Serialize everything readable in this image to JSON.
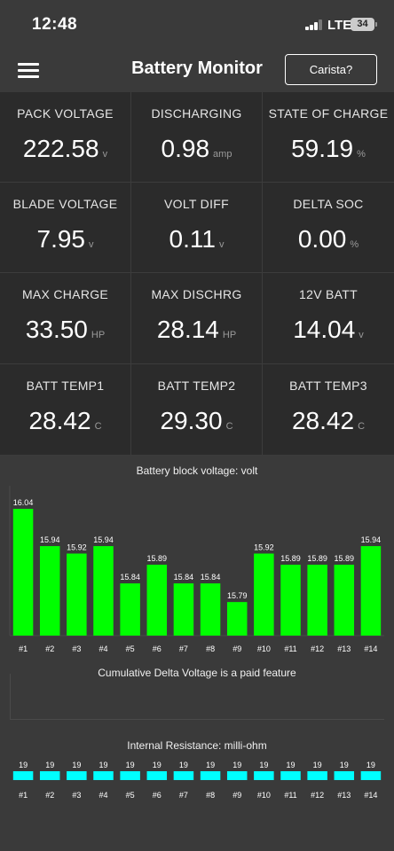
{
  "status_bar": {
    "time": "12:48",
    "network": "LTE",
    "battery_level": "34"
  },
  "header": {
    "title": "Battery Monitor",
    "button_label": "Carista?"
  },
  "metrics": [
    {
      "label": "PACK VOLTAGE",
      "value": "222.58",
      "unit": "v"
    },
    {
      "label": "DISCHARGING",
      "value": "0.98",
      "unit": "amp"
    },
    {
      "label": "STATE OF CHARGE",
      "value": "59.19",
      "unit": "%"
    },
    {
      "label": "BLADE VOLTAGE",
      "value": "7.95",
      "unit": "v"
    },
    {
      "label": "VOLT DIFF",
      "value": "0.11",
      "unit": "v"
    },
    {
      "label": "DELTA SOC",
      "value": "0.00",
      "unit": "%"
    },
    {
      "label": "MAX CHARGE",
      "value": "33.50",
      "unit": "HP"
    },
    {
      "label": "MAX DISCHRG",
      "value": "28.14",
      "unit": "HP"
    },
    {
      "label": "12V BATT",
      "value": "14.04",
      "unit": "v"
    },
    {
      "label": "BATT TEMP1",
      "value": "28.42",
      "unit": "C"
    },
    {
      "label": "BATT TEMP2",
      "value": "29.30",
      "unit": "C"
    },
    {
      "label": "BATT TEMP3",
      "value": "28.42",
      "unit": "C"
    }
  ],
  "delta_voltage_notice": "Cumulative Delta Voltage is a paid feature",
  "colors": {
    "voltage_bar": "#00ff00",
    "resistance_bar": "#00ffff",
    "cell_background": "#2b2b2b",
    "page_background": "#3a3a3a"
  },
  "chart_data": [
    {
      "type": "bar",
      "title": "Battery block voltage: volt",
      "categories": [
        "#1",
        "#2",
        "#3",
        "#4",
        "#5",
        "#6",
        "#7",
        "#8",
        "#9",
        "#10",
        "#11",
        "#12",
        "#13",
        "#14"
      ],
      "values": [
        16.04,
        15.94,
        15.92,
        15.94,
        15.84,
        15.89,
        15.84,
        15.84,
        15.79,
        15.92,
        15.89,
        15.89,
        15.89,
        15.94
      ],
      "value_labels": [
        "16.04",
        "15.94",
        "15.92",
        "15.94",
        "15.84",
        "15.89",
        "15.84",
        "15.84",
        "15.79",
        "15.92",
        "15.89",
        "15.89",
        "15.89",
        "15.94"
      ],
      "ylim": [
        15.7,
        16.04
      ],
      "grid": false,
      "color": "#00ff00"
    },
    {
      "type": "bar",
      "title": "Internal Resistance: milli-ohm",
      "categories": [
        "#1",
        "#2",
        "#3",
        "#4",
        "#5",
        "#6",
        "#7",
        "#8",
        "#9",
        "#10",
        "#11",
        "#12",
        "#13",
        "#14"
      ],
      "values": [
        19,
        19,
        19,
        19,
        19,
        19,
        19,
        19,
        19,
        19,
        19,
        19,
        19,
        19
      ],
      "value_labels": [
        "19",
        "19",
        "19",
        "19",
        "19",
        "19",
        "19",
        "19",
        "19",
        "19",
        "19",
        "19",
        "19",
        "19"
      ],
      "grid": false,
      "color": "#00ffff"
    }
  ]
}
